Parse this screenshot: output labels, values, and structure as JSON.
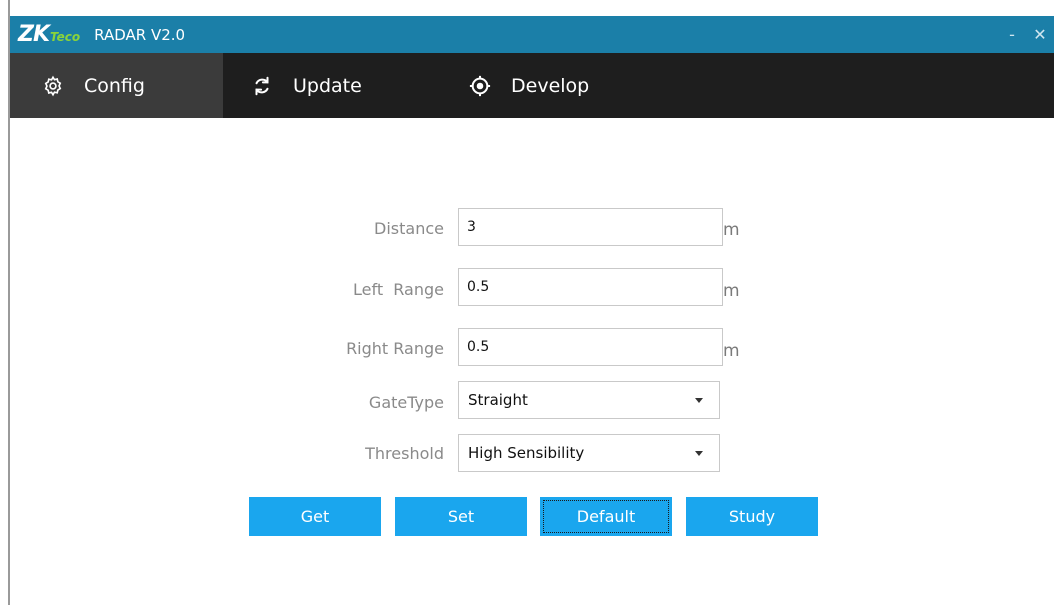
{
  "window": {
    "logo_main": "ZK",
    "logo_sub": "Teco",
    "title": "RADAR V2.0",
    "minimize_label": "-",
    "close_label": "✕"
  },
  "tabs": [
    {
      "label": "Config",
      "icon": "gear-icon",
      "active": true
    },
    {
      "label": "Update",
      "icon": "refresh-icon",
      "active": false
    },
    {
      "label": "Develop",
      "icon": "target-icon",
      "active": false
    }
  ],
  "form": {
    "distance": {
      "label": "Distance",
      "value": "3",
      "unit": "m"
    },
    "left_range": {
      "label": "Left  Range",
      "value": "0.5",
      "unit": "m"
    },
    "right_range": {
      "label": "Right Range",
      "value": "0.5",
      "unit": "m"
    },
    "gate_type": {
      "label": "GateType",
      "value": "Straight"
    },
    "threshold": {
      "label": "Threshold",
      "value": "High Sensibility"
    }
  },
  "buttons": {
    "get": "Get",
    "set": "Set",
    "default": "Default",
    "study": "Study"
  },
  "colors": {
    "titlebar": "#1b7fa8",
    "tabbar": "#1e1e1e",
    "active_tab": "#3b3b3b",
    "button": "#1aa6ee",
    "logo_accent": "#8bd43a"
  }
}
